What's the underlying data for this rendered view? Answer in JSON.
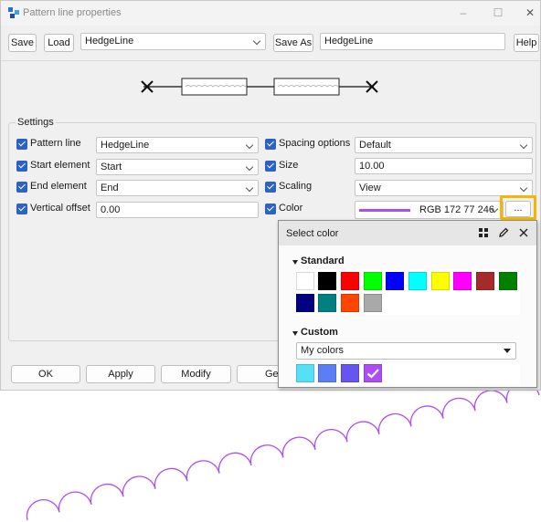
{
  "window": {
    "title": "Pattern line properties"
  },
  "toolbar": {
    "save_label": "Save",
    "load_label": "Load",
    "pattern_select_value": "HedgeLine",
    "save_as_label": "Save As",
    "save_as_name": "HedgeLine",
    "help_label": "Help"
  },
  "settings": {
    "group_label": "Settings",
    "rows": [
      {
        "label": "Pattern line",
        "value": "HedgeLine"
      },
      {
        "label": "Start element",
        "value": "Start"
      },
      {
        "label": "End element",
        "value": "End"
      },
      {
        "label": "Vertical offset",
        "value": "0.00"
      },
      {
        "label": "Spacing options",
        "value": "Default"
      },
      {
        "label": "Size",
        "value": "10.00"
      },
      {
        "label": "Scaling",
        "value": "View"
      },
      {
        "label": "Color",
        "value": "RGB 172 77 246"
      }
    ],
    "color_more_label": "..."
  },
  "colors": {
    "current": "#ac4df6",
    "accent": "#2c62c4",
    "highlight": "#f2b705"
  },
  "bottom_buttons": {
    "ok": "OK",
    "apply": "Apply",
    "modify": "Modify",
    "get": "Get"
  },
  "select_color": {
    "title": "Select color",
    "standard_label": "Standard",
    "standard_colors": [
      "#ffffff",
      "#000000",
      "#ff0000",
      "#00ff00",
      "#0000ff",
      "#00ffff",
      "#ffff00",
      "#ff00ff",
      "#a52a2a",
      "#008000",
      "#000080",
      "#008080",
      "#ff4500",
      "#a9a9a9"
    ],
    "custom_label": "Custom",
    "custom_list_value": "My colors",
    "custom_colors": [
      "#55e0f5",
      "#5b7ef5",
      "#6655f0",
      "#ac4df6"
    ],
    "icons": [
      "grid-icon",
      "pencil-icon",
      "close-icon"
    ]
  }
}
